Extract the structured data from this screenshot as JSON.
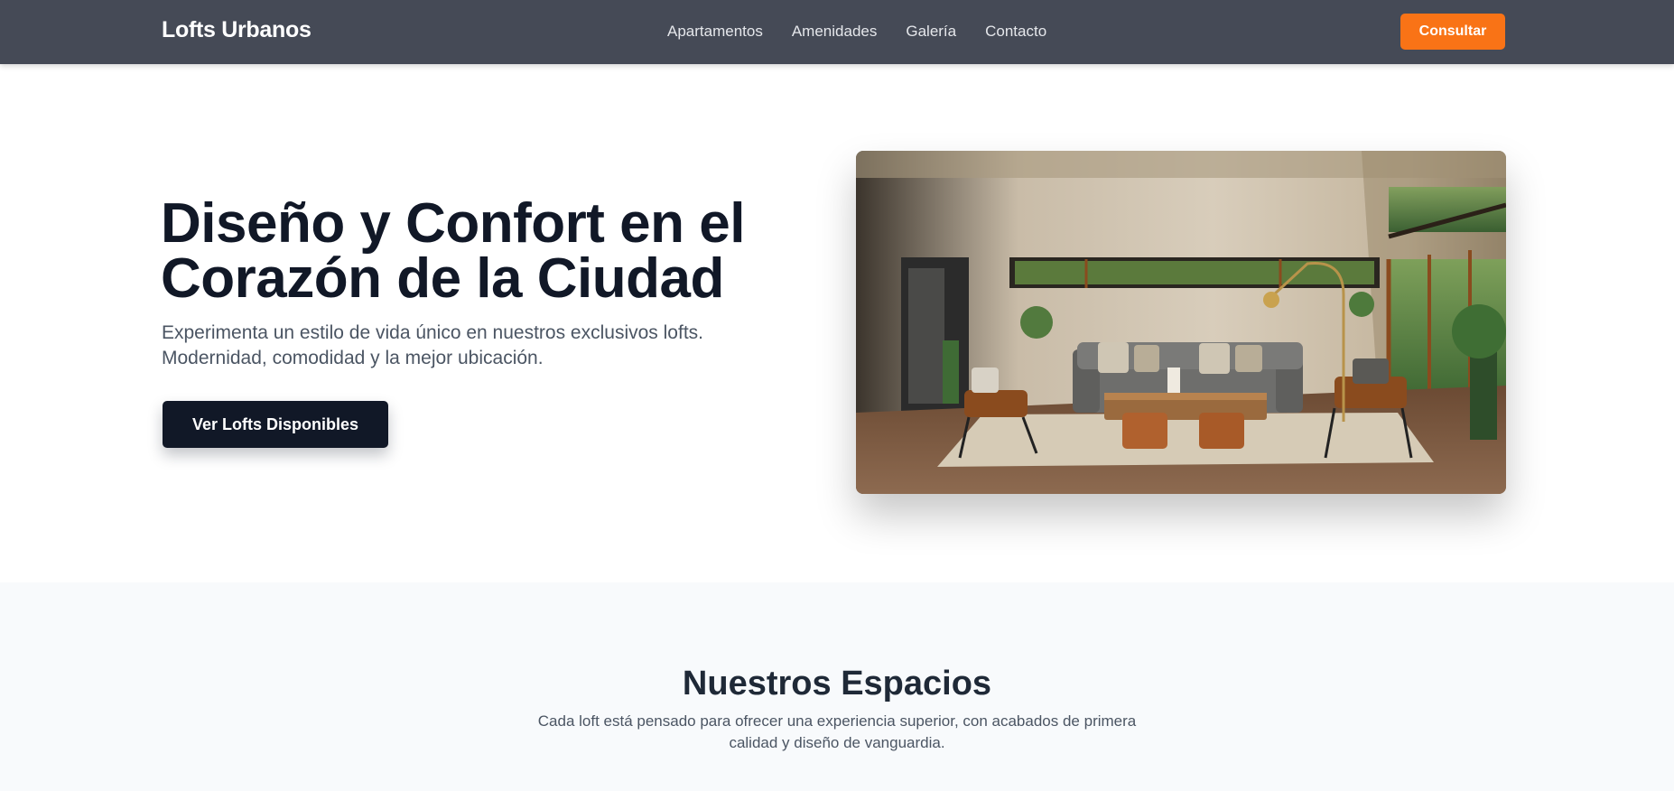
{
  "header": {
    "logo": "Lofts Urbanos",
    "nav": [
      "Apartamentos",
      "Amenidades",
      "Galería",
      "Contacto"
    ],
    "cta_label": "Consultar"
  },
  "hero": {
    "title": "Diseño y Confort en el Corazón de la Ciudad",
    "subtitle": "Experimenta un estilo de vida único en nuestros exclusivos lofts. Modernidad, comodidad y la mejor ubicación.",
    "button_label": "Ver Lofts Disponibles"
  },
  "spaces": {
    "title": "Nuestros Espacios",
    "description": "Cada loft está pensado para ofrecer una experiencia superior, con acabados de primera calidad y diseño de vanguardia."
  },
  "colors": {
    "nav_background": "#454a56",
    "accent": "#f97316",
    "dark_button": "#111827",
    "section_background": "#f8fafc"
  }
}
